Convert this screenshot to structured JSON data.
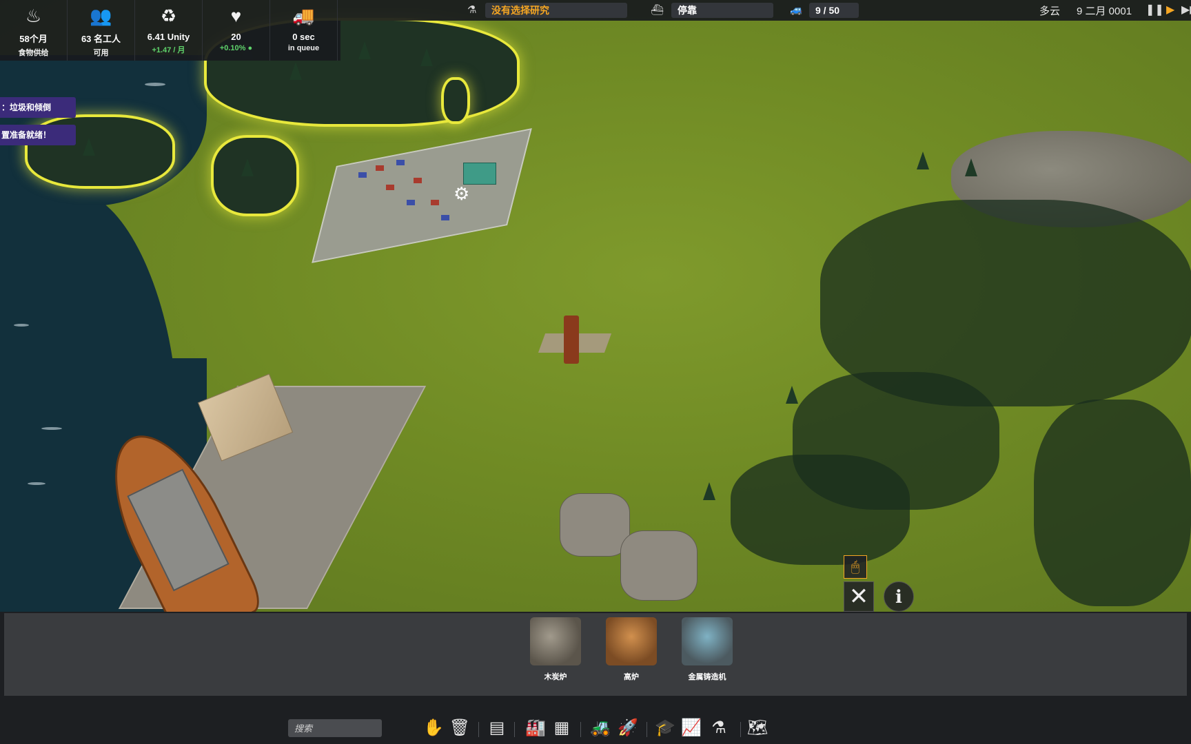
{
  "stats": [
    {
      "icon": "food-bowl-icon",
      "glyph": "♨",
      "value": "58个月",
      "sub": "食物供给",
      "sub_color": "white"
    },
    {
      "icon": "workers-icon",
      "glyph": "👥",
      "value": "63 名工人",
      "sub": "可用",
      "sub_color": "white"
    },
    {
      "icon": "unity-icon",
      "glyph": "♻",
      "value": "6.41 Unity",
      "sub": "+1.47 / 月",
      "sub_color": "green"
    },
    {
      "icon": "health-heart-icon",
      "glyph": "♥",
      "value": "20",
      "sub": "+0.10%",
      "sub_color": "green"
    },
    {
      "icon": "truck-queue-icon",
      "glyph": "🚚",
      "value": "0 sec",
      "sub": "in queue",
      "sub_color": "white"
    }
  ],
  "topbar": {
    "research": "没有选择研究",
    "research_icon": "flask-icon",
    "research_color": "#f5a623",
    "ship_status": "停靠",
    "ship_icon": "ship-icon",
    "vehicles": "9 / 50",
    "vehicle_icon": "vehicle-icon",
    "weather": "多云",
    "date": "9 二月 0001",
    "pause_icon": "pause-icon",
    "play_icon": "play-icon",
    "fast_icon": "fast-forward-icon",
    "accent": "#f5a623"
  },
  "notifications": [
    "：垃圾和倾倒",
    "置准备就绪！"
  ],
  "map_tools": {
    "mouse_icon": "mouse-icon",
    "demolish_icon": "demolish-cross-icon",
    "info_icon": "info-icon"
  },
  "build_items": [
    {
      "label": "木炭炉",
      "icon": "charcoal-kiln-icon"
    },
    {
      "label": "高炉",
      "icon": "blast-furnace-icon"
    },
    {
      "label": "金属铸造机",
      "icon": "metal-caster-icon"
    }
  ],
  "toolbar": {
    "search_placeholder": "搜索",
    "groups": [
      [
        {
          "name": "hand-tool-icon",
          "glyph": "✋"
        },
        {
          "name": "recycle-bin-icon",
          "glyph": "🗑"
        }
      ],
      [
        {
          "name": "conveyor-icon",
          "glyph": "▤"
        }
      ],
      [
        {
          "name": "factory-icon",
          "glyph": "🏭"
        },
        {
          "name": "storage-icon",
          "glyph": "▦"
        }
      ],
      [
        {
          "name": "vehicles-icon",
          "glyph": "🚜"
        },
        {
          "name": "rocket-icon",
          "glyph": "🚀"
        }
      ],
      [
        {
          "name": "education-icon",
          "glyph": "🎓"
        },
        {
          "name": "stats-chart-icon",
          "glyph": "📈"
        },
        {
          "name": "research-flask-icon",
          "glyph": "⚗"
        }
      ],
      [
        {
          "name": "map-icon",
          "glyph": "🗺"
        }
      ]
    ]
  }
}
